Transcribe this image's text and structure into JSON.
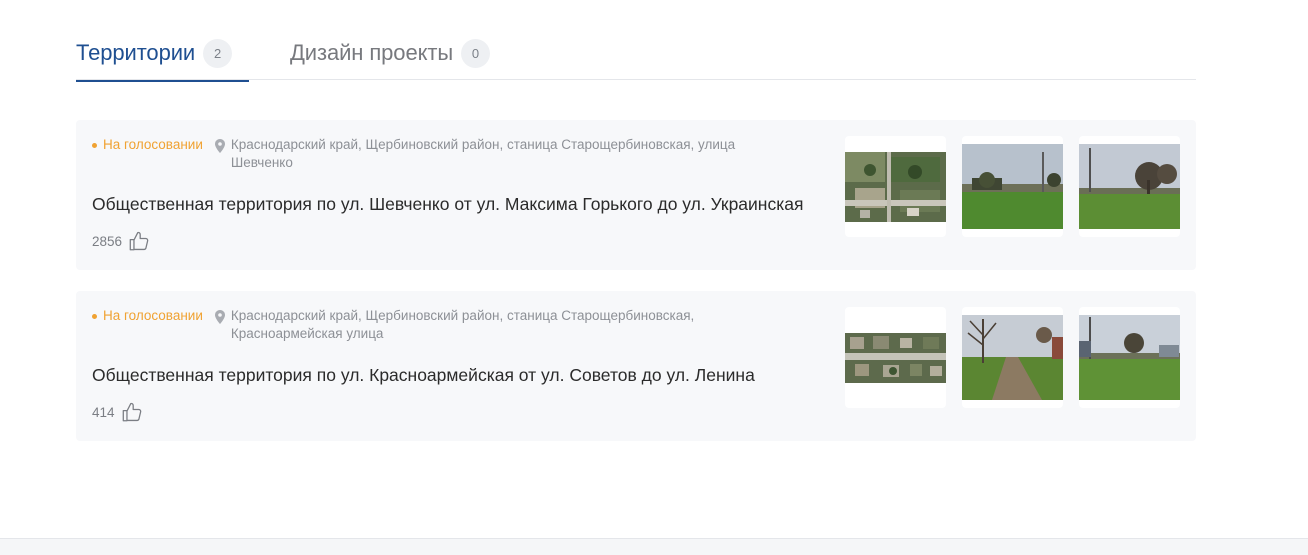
{
  "tabs": [
    {
      "label": "Территории",
      "count": "2"
    },
    {
      "label": "Дизайн проекты",
      "count": "0"
    }
  ],
  "colors": {
    "accent": "#1f4f91",
    "status": "#f0a232",
    "card_bg": "#f7f8fa"
  },
  "cards": [
    {
      "status": "На голосовании",
      "address": "Краснодарский край, Щербиновский район, станица Старощербиновская, улица Шевченко",
      "title": "Общественная территория по ул. Шевченко от ул. Максима Горького до ул. Украинская",
      "likes": "2856",
      "photos": [
        "satellite-map-photo",
        "street-photo",
        "field-photo"
      ]
    },
    {
      "status": "На голосовании",
      "address": "Краснодарский край, Щербиновский район, станица Старощербиновская, Красноармейская улица",
      "title": "Общественная территория по ул. Красноармейская от ул. Советов до ул. Ленина",
      "likes": "414",
      "photos": [
        "satellite-map-photo",
        "path-photo",
        "field-photo"
      ]
    }
  ]
}
